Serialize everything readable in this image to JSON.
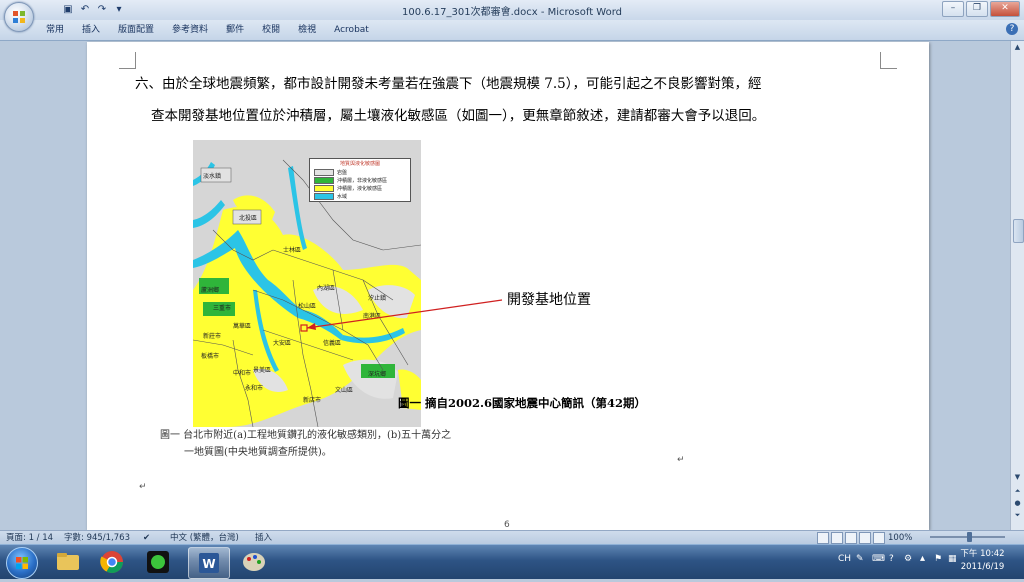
{
  "window": {
    "title": "100.6.17_301次都審會.docx - Microsoft Word"
  },
  "ribbon": {
    "tabs": [
      "常用",
      "插入",
      "版面配置",
      "參考資料",
      "郵件",
      "校閱",
      "檢視",
      "Acrobat"
    ]
  },
  "document": {
    "line1": "六、由於全球地震頻繁，都市設計開發未考量若在強震下（地震規模 7.5），可能引起之不良影響對策，經",
    "line2": "查本開發基地位置位於沖積層，屬土壤液化敏感區（如圖一），更無章節敘述，建請都審大會予以退回。",
    "callout_label": "開發基地位置",
    "figure_caption_bold": "圖一  摘自2002.6國家地震中心簡訊（第42期）",
    "figure_caption_line1": "圖一  台北市附近(a)工程地質鑽孔的液化敏感類別，(b)五十萬分之",
    "figure_caption_line2": "一地質圖(中央地質調查所提供)。",
    "page_number": "6",
    "map": {
      "legend_title": "地質與液化敏感圖",
      "legend_items": [
        {
          "label": "岩盤",
          "color": "#e2e2e2"
        },
        {
          "label": "沖積層，非液化敏感區",
          "color": "#2fb53a"
        },
        {
          "label": "沖積層，液化敏感區",
          "color": "#ffff33"
        },
        {
          "label": "水域",
          "color": "#2bc4e6"
        }
      ],
      "place_labels": [
        "淡水鎮",
        "北投區",
        "士林區",
        "內湖區",
        "汐止鎮",
        "蘆洲鄉",
        "三重市",
        "松山區",
        "南港區",
        "新莊市",
        "大安區",
        "信義區",
        "板橋市",
        "中和市",
        "永和市",
        "景美區",
        "深坑鄉",
        "新店市",
        "文山區",
        "萬華區"
      ]
    }
  },
  "statusbar": {
    "page": "頁面: 1 / 14",
    "words": "字數: 945/1,763",
    "language": "中文 (繁體，台灣)",
    "mode": "插入",
    "zoom": "100%"
  },
  "taskbar": {
    "tray_lang": "CH",
    "time": "下午 10:42",
    "date": "2011/6/19"
  },
  "colors": {
    "accent": "#2f5b92",
    "map_yellow": "#ffff33",
    "map_water": "#2bc4e6",
    "map_green": "#2fb53a"
  }
}
